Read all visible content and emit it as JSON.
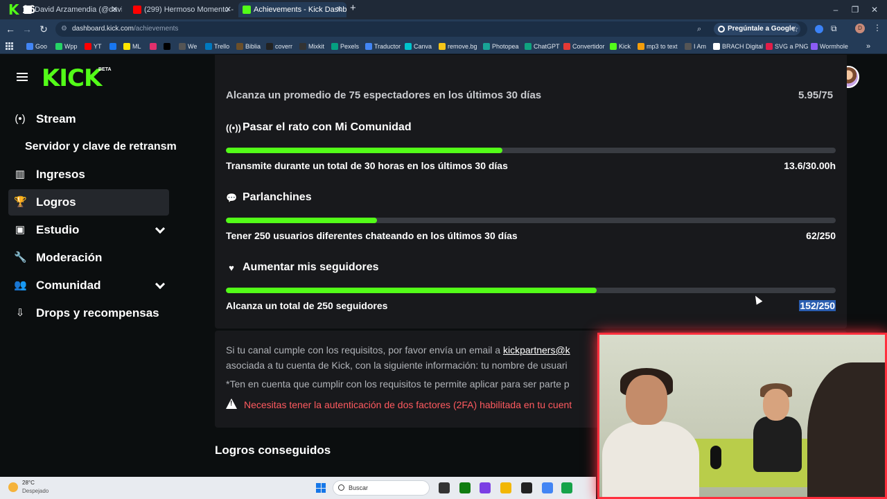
{
  "browser": {
    "corner_badge": "16",
    "tabs": [
      {
        "title": "David Arzamendia (@davi",
        "active": false,
        "favicon_color": "#ffffff"
      },
      {
        "title": "(299) Hermoso Momento - Kai",
        "active": false,
        "favicon_color": "#ff0000"
      },
      {
        "title": "Achievements - Kick Dashboard",
        "active": true,
        "favicon_color": "#53fc18"
      }
    ],
    "new_tab_label": "+",
    "window_controls": [
      "–",
      "❐",
      "✕"
    ],
    "url_host": "dashboard.kick.com",
    "url_path": "/achievements",
    "google_ask": "Pregúntale a Google",
    "profile_initial": "D",
    "bookmarks": [
      {
        "label": "Goo",
        "color": "#4285f4"
      },
      {
        "label": "Wpp",
        "color": "#25d366"
      },
      {
        "label": "YT",
        "color": "#ff0000"
      },
      {
        "label": "",
        "color": "#1877f2"
      },
      {
        "label": "ML",
        "color": "#ffe600"
      },
      {
        "label": "",
        "color": "#e1306c"
      },
      {
        "label": "",
        "color": "#000000"
      },
      {
        "label": "We",
        "color": "#555555"
      },
      {
        "label": "Trello",
        "color": "#0079bf"
      },
      {
        "label": "Biblia",
        "color": "#6b4f2a"
      },
      {
        "label": "coverr",
        "color": "#222222"
      },
      {
        "label": "Mixkit",
        "color": "#333333"
      },
      {
        "label": "Pexels",
        "color": "#05a081"
      },
      {
        "label": "Traductor",
        "color": "#4285f4"
      },
      {
        "label": "Canva",
        "color": "#00c4cc"
      },
      {
        "label": "remove.bg",
        "color": "#f5c518"
      },
      {
        "label": "Photopea",
        "color": "#18a497"
      },
      {
        "label": "ChatGPT",
        "color": "#10a37f"
      },
      {
        "label": "Convertidor",
        "color": "#e53935"
      },
      {
        "label": "Kick",
        "color": "#53fc18"
      },
      {
        "label": "mp3 to text",
        "color": "#f59e0b"
      },
      {
        "label": "I Am",
        "color": "#555555"
      },
      {
        "label": "BRACH Digital",
        "color": "#ffffff"
      },
      {
        "label": "SVG a PNG",
        "color": "#e11d48"
      },
      {
        "label": "Wormhole",
        "color": "#8b5cf6"
      }
    ],
    "more_label": "»"
  },
  "kick": {
    "logo": "KICK",
    "beta": "BETA",
    "accent": "#53fc18"
  },
  "sidebar": {
    "items": [
      {
        "label": "Stream",
        "icon": "broadcast-icon",
        "glyph": "(•)",
        "expandable": false,
        "active": false
      },
      {
        "label": "Ingresos",
        "icon": "bar-chart-icon",
        "glyph": "▥",
        "expandable": false,
        "active": false
      },
      {
        "label": "Logros",
        "icon": "trophy-icon",
        "glyph": "🏆",
        "expandable": false,
        "active": true
      },
      {
        "label": "Estudio",
        "icon": "studio-icon",
        "glyph": "▣",
        "expandable": true,
        "active": false
      },
      {
        "label": "Moderación",
        "icon": "wrench-icon",
        "glyph": "🔧",
        "expandable": false,
        "active": false
      },
      {
        "label": "Comunidad",
        "icon": "users-icon",
        "glyph": "👥",
        "expandable": true,
        "active": false
      },
      {
        "label": "Drops y recompensas",
        "icon": "drops-icon",
        "glyph": "⇩",
        "expandable": false,
        "active": false
      }
    ],
    "sub_item": "Servidor y clave de retransm"
  },
  "achievements": {
    "cut_off": {
      "text": "Alcanza un promedio de 75 espectadores en los últimos 30 días",
      "value": "5.95/75"
    },
    "list": [
      {
        "title": "Pasar el rato con Mi Comunidad",
        "icon": "broadcast-icon",
        "glyph": "((•))",
        "description": "Transmite durante un total de 30 horas en los últimos 30 días",
        "value": "13.6/30.00h",
        "progress": 0.453,
        "selected": false
      },
      {
        "title": "Parlanchines",
        "icon": "chat-bubble-icon",
        "glyph": "💬",
        "description": "Tener 250 usuarios diferentes chateando en los últimos 30 días",
        "value": "62/250",
        "progress": 0.248,
        "selected": false
      },
      {
        "title": "Aumentar mis seguidores",
        "icon": "heart-icon",
        "glyph": "♥",
        "description": "Alcanza un total de 250 seguidores",
        "value": "152/250",
        "progress": 0.608,
        "selected": true
      }
    ]
  },
  "info": {
    "line1_prefix": "Si tu canal cumple con los requisitos, por favor envía un email a ",
    "line1_link": "kickpartners@k",
    "line2": "asociada a tu cuenta de Kick, con la siguiente información: tu nombre de usuari",
    "line3": "*Ten en cuenta que cumplir con los requisitos te permite aplicar para ser parte p",
    "warning": "Necesitas tener la autenticación de dos factores (2FA) habilitada en tu cuent"
  },
  "section_heading": "Logros conseguidos",
  "taskbar": {
    "weather_temp": "28°C",
    "weather_desc": "Despejado",
    "search_placeholder": "Buscar",
    "apps": [
      {
        "icon": "task-view-icon",
        "color": "#333333"
      },
      {
        "icon": "xbox-icon",
        "color": "#107c10"
      },
      {
        "icon": "app-icon",
        "color": "#7b3fe4"
      },
      {
        "icon": "folder-icon",
        "color": "#f2b705"
      },
      {
        "icon": "obs-icon",
        "color": "#222222"
      },
      {
        "icon": "chrome-icon",
        "color": "#4285f4"
      },
      {
        "icon": "app-green-icon",
        "color": "#16a34a"
      }
    ]
  },
  "webcam": {
    "border_color": "#ff2f3d"
  }
}
